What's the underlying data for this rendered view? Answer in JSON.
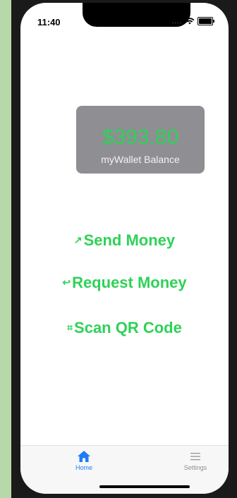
{
  "status_bar": {
    "time": "11:40",
    "signal_dots": "....",
    "wifi_icon": "wifi-icon",
    "battery_icon": "battery-icon"
  },
  "balance": {
    "amount": "$393.80",
    "label": "myWallet Balance",
    "amount_color": "#2fd158",
    "card_color": "#8e8e93"
  },
  "actions": {
    "send": {
      "icon": "↗",
      "label": "Send Money"
    },
    "request": {
      "icon": "↩",
      "label": "Request Money"
    },
    "scan": {
      "icon": "⌗",
      "label": "Scan QR Code"
    }
  },
  "tabs": [
    {
      "label": "Home",
      "icon": "home-icon",
      "active": true
    },
    {
      "label": "Settings",
      "icon": "menu-icon",
      "active": false
    }
  ],
  "accent_color": "#2fd158",
  "tab_active_color": "#1f7cf6"
}
